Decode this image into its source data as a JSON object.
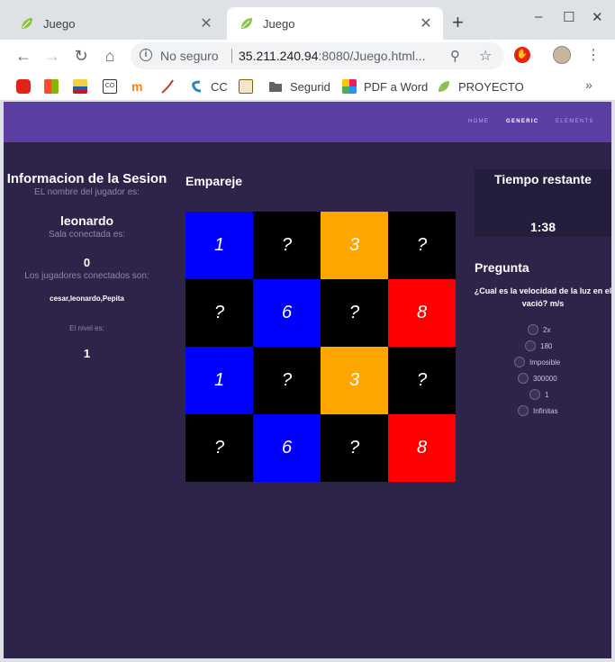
{
  "browser": {
    "tabs": [
      {
        "title": "Juego",
        "active": false
      },
      {
        "title": "Juego",
        "active": true
      }
    ],
    "new_tab": "+",
    "window_controls": {
      "minimize": "–",
      "maximize": "☐",
      "close": "✕"
    },
    "address": {
      "security_label": "No seguro",
      "host": "35.211.240.94",
      "rest": ":8080/Juego.html..."
    },
    "bookmarks": [
      {
        "label": "",
        "icon": "youtube-icon",
        "color": "#e62117"
      },
      {
        "label": "",
        "icon": "office-icon",
        "color": "#f25022"
      },
      {
        "label": "",
        "icon": "colombia-flag-icon",
        "color": "#f4d03f"
      },
      {
        "label": "",
        "icon": "cc-icon",
        "color": "#333333"
      },
      {
        "label": "",
        "icon": "moodle-icon",
        "color": "#f98012"
      },
      {
        "label": "",
        "icon": "swoosh-icon",
        "color": "#c0392b"
      },
      {
        "label": "CC",
        "icon": "cc-swirl-icon",
        "color": "#2e86c1"
      },
      {
        "label": "",
        "icon": "image-icon",
        "color": "#7d6608"
      },
      {
        "label": "Segurid",
        "icon": "folder-icon",
        "color": "#5f6368"
      },
      {
        "label": "PDF a Word",
        "icon": "pdf-word-icon",
        "color": "#e91e63"
      },
      {
        "label": "PROYECTO",
        "icon": "leaf-icon",
        "color": "#8bc34a"
      }
    ],
    "bookmarks_more": "»"
  },
  "site_nav": [
    "HOME",
    "GENERIC",
    "ELEMENTS"
  ],
  "session": {
    "title": "Informacion de la Sesion",
    "player_label": "EL nombre del jugador es:",
    "player": "leonardo",
    "room_label": "Sala conectada es:",
    "room": "0",
    "players_label": "Los jugadores conectados son:",
    "players": "cesar,leonardo,Pepita",
    "level_label": "El nivel es:",
    "level": "1"
  },
  "board": {
    "title": "Empareje",
    "cells": [
      {
        "text": "1",
        "color": "#0000ff"
      },
      {
        "text": "?",
        "color": "#000000"
      },
      {
        "text": "3",
        "color": "#ffa500"
      },
      {
        "text": "?",
        "color": "#000000"
      },
      {
        "text": "?",
        "color": "#000000"
      },
      {
        "text": "6",
        "color": "#0000ff"
      },
      {
        "text": "?",
        "color": "#000000"
      },
      {
        "text": "8",
        "color": "#ff0000"
      },
      {
        "text": "1",
        "color": "#0000ff"
      },
      {
        "text": "?",
        "color": "#000000"
      },
      {
        "text": "3",
        "color": "#ffa500"
      },
      {
        "text": "?",
        "color": "#000000"
      },
      {
        "text": "?",
        "color": "#000000"
      },
      {
        "text": "6",
        "color": "#0000ff"
      },
      {
        "text": "?",
        "color": "#000000"
      },
      {
        "text": "8",
        "color": "#ff0000"
      }
    ]
  },
  "timer": {
    "title": "Tiempo restante",
    "value": "1:38"
  },
  "question": {
    "title": "Pregunta",
    "text": "¿Cual es la velocidad de la luz en el vació? m/s",
    "options": [
      "2x",
      "180",
      "Imposible",
      "300000",
      "1",
      "Infinitas"
    ]
  }
}
